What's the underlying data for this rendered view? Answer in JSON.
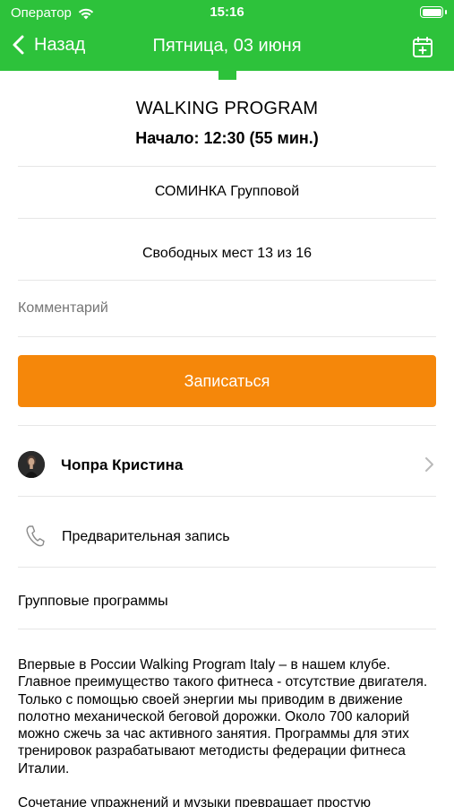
{
  "status_bar": {
    "carrier": "Оператор",
    "time": "15:16"
  },
  "nav": {
    "back_label": "Назад",
    "title": "Пятница, 03 июня"
  },
  "colors": {
    "brand_green": "#2dc23b",
    "accent_orange": "#f5870a"
  },
  "icons": {
    "wifi": "wifi-icon",
    "battery": "battery-icon",
    "back": "chevron-left-icon",
    "calendar": "calendar-add-icon",
    "trainer_chevron": "chevron-right-icon",
    "phone": "phone-icon"
  },
  "session": {
    "title": "WALKING PROGRAM",
    "start": "Начало: 12:30 (55 мин.)",
    "type": "СОМИНКА Групповой",
    "seats": "Свободных мест 13 из 16"
  },
  "comment": {
    "placeholder": "Комментарий"
  },
  "enroll_button": "Записаться",
  "trainer": {
    "name": "Чопра Кристина"
  },
  "booking": {
    "label": "Предварительная запись"
  },
  "category": "Групповые программы",
  "description": "Впервые в России Walking Program Italy – в нашем клубе. Главное преимущество такого фитнеса - отсутствие двигателя. Только с помощью своей энергии мы приводим в движение полотно механической беговой дорожки. Около 700 калорий можно сжечь за час активного занятия. Программы для этих тренировок разрабатывают методисты федерации фитнеса Италии.\n\nСочетание упражнений и музыки превращает простую"
}
